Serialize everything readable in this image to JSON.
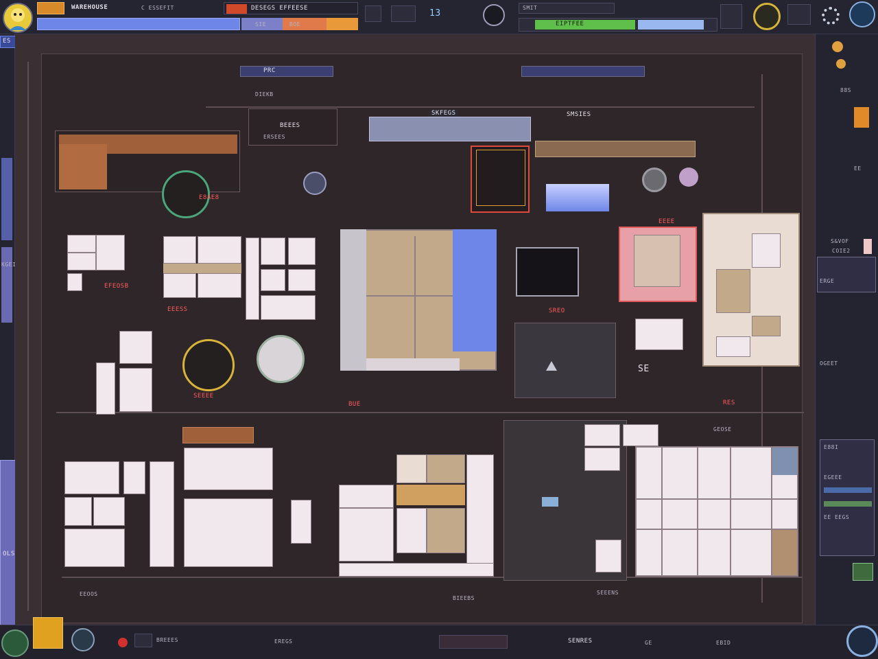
{
  "topbar": {
    "title": "WAREHOUSE",
    "subtitle": "C ESSEFIT",
    "mid_label": "DESEGS EFFEESE",
    "tab_a": "SIE",
    "tab_b": "BOE",
    "readout": "13",
    "level_label": "SMIT",
    "meter_label": "EIPTFEE"
  },
  "left_panel": {
    "chip": "ES",
    "vert_label": "KGEIE",
    "tag": "OLS"
  },
  "right_panel": {
    "labels": [
      "88S",
      "EE",
      "S&VOF",
      "COIE2",
      "ERGE",
      "OGEET"
    ],
    "legend": [
      "E88I",
      "EGEEE",
      "EE EEGS"
    ]
  },
  "map": {
    "labels": {
      "header_a": "PRC",
      "header_b": "DIEKB",
      "header_c": "SKFEGS",
      "header_d": "SMSIES",
      "block_a": "BEEES",
      "block_b": "ERSEES",
      "label_e": "E8AE8",
      "label_f": "EFEOSB",
      "label_g": "EEESS",
      "label_h": "SREO",
      "label_i": "EEEE",
      "label_j": "SE",
      "label_k": "RES",
      "label_l": "SEEEE",
      "label_m": "BUE",
      "label_n": "GEOSE",
      "foot_a": "EEOOS",
      "foot_b": "BIEEBS",
      "foot_c": "SEEENS"
    }
  },
  "bottombar": {
    "status_a": "BREEES",
    "status_b": "EREGS",
    "status_c": "SENRES",
    "status_d": "EBID",
    "coords": "GE"
  },
  "colors": {
    "floor": "#2e2629",
    "accent_blue": "#6e86e8",
    "accent_orange": "#e07a2a",
    "accent_green": "#4ba77a",
    "accent_red": "#ff5a5a"
  },
  "icons": [
    "character-portrait-icon",
    "compass-icon",
    "gear-icon",
    "shield-icon",
    "minimap-icon"
  ]
}
